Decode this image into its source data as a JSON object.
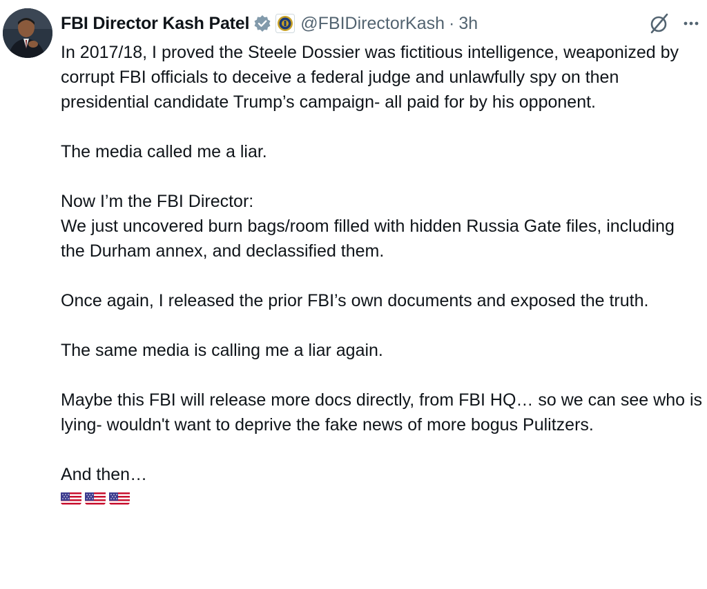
{
  "post": {
    "author": {
      "display_name": "FBI Director Kash Patel",
      "handle": "@FBIDirectorKash",
      "verified_badge": "gray-check-icon",
      "affiliate_badge": "fbi-seal-icon"
    },
    "separator": "·",
    "time": "3h",
    "actions": {
      "grok_icon": "grok-icon",
      "more_icon": "more-icon"
    },
    "paragraphs": [
      "In 2017/18, I proved the Steele Dossier was fictitious intelligence, weaponized by corrupt FBI officials to deceive a federal judge and unlawfully spy on then presidential candidate Trump’s campaign- all paid for by his opponent.",
      "The media called me a liar.",
      [
        "Now I’m the FBI Director:",
        "We just uncovered burn bags/room filled with hidden Russia Gate files, including the Durham annex, and declassified them."
      ],
      "Once again, I released the prior FBI’s own documents and exposed the truth.",
      "The same media is calling me a liar again.",
      "Maybe this FBI will release more docs directly, from FBI HQ… so we can see who is lying- wouldn't want to deprive the fake news of more bogus Pulitzers.",
      "And then…"
    ],
    "flags": [
      "us-flag-emoji",
      "us-flag-emoji",
      "us-flag-emoji"
    ]
  },
  "colors": {
    "text": "#0f1419",
    "muted": "#536471",
    "badge_gray": "#829aab"
  }
}
